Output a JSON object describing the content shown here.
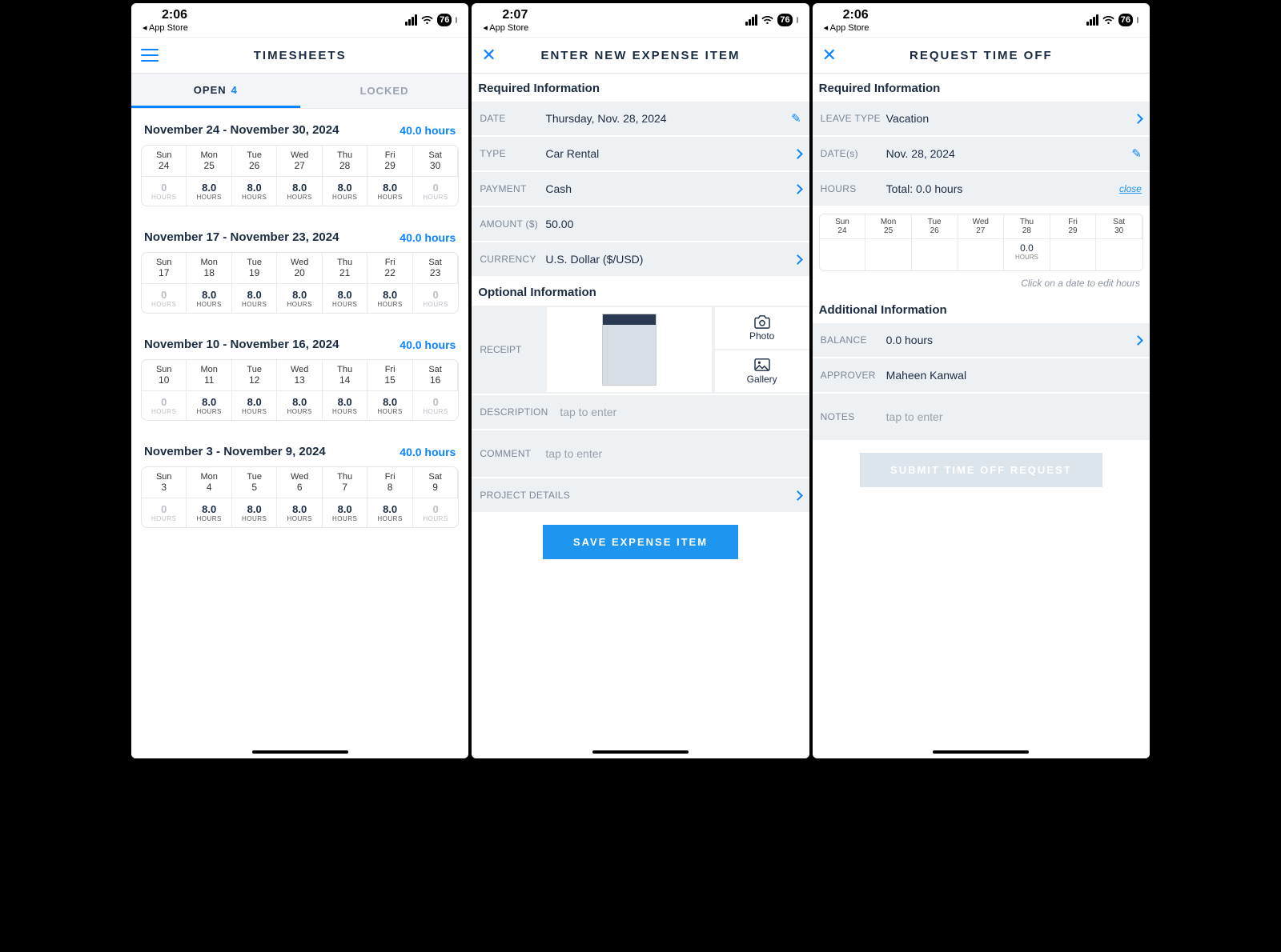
{
  "status": {
    "back": "◂ App Store",
    "battery": "76"
  },
  "screen1": {
    "time": "2:06",
    "title": "TIMESHEETS",
    "tabs": {
      "open_label": "OPEN",
      "open_count": "4",
      "locked_label": "LOCKED"
    },
    "dows": [
      "Sun",
      "Mon",
      "Tue",
      "Wed",
      "Thu",
      "Fri",
      "Sat"
    ],
    "weeks": [
      {
        "range": "November 24 - November 30, 2024",
        "total": "40.0 hours",
        "dates": [
          "24",
          "25",
          "26",
          "27",
          "28",
          "29",
          "30"
        ],
        "hours": [
          "0",
          "8.0",
          "8.0",
          "8.0",
          "8.0",
          "8.0",
          "0"
        ]
      },
      {
        "range": "November 17 - November 23, 2024",
        "total": "40.0 hours",
        "dates": [
          "17",
          "18",
          "19",
          "20",
          "21",
          "22",
          "23"
        ],
        "hours": [
          "0",
          "8.0",
          "8.0",
          "8.0",
          "8.0",
          "8.0",
          "0"
        ]
      },
      {
        "range": "November 10 - November 16, 2024",
        "total": "40.0 hours",
        "dates": [
          "10",
          "11",
          "12",
          "13",
          "14",
          "15",
          "16"
        ],
        "hours": [
          "0",
          "8.0",
          "8.0",
          "8.0",
          "8.0",
          "8.0",
          "0"
        ]
      },
      {
        "range": "November 3 - November 9, 2024",
        "total": "40.0 hours",
        "dates": [
          "3",
          "4",
          "5",
          "6",
          "7",
          "8",
          "9"
        ],
        "hours": [
          "0",
          "8.0",
          "8.0",
          "8.0",
          "8.0",
          "8.0",
          "0"
        ]
      }
    ],
    "unit": "HOURS"
  },
  "screen2": {
    "time": "2:07",
    "title": "ENTER NEW EXPENSE ITEM",
    "section_required": "Required Information",
    "section_optional": "Optional Information",
    "fields": {
      "date_label": "DATE",
      "date_value": "Thursday, Nov. 28, 2024",
      "type_label": "TYPE",
      "type_value": "Car Rental",
      "payment_label": "PAYMENT",
      "payment_value": "Cash",
      "amount_label": "AMOUNT ($)",
      "amount_value": "50.00",
      "currency_label": "CURRENCY",
      "currency_value": "U.S. Dollar ($/USD)",
      "receipt_label": "RECEIPT",
      "photo_label": "Photo",
      "gallery_label": "Gallery",
      "description_label": "DESCRIPTION",
      "description_placeholder": "tap to enter",
      "comment_label": "COMMENT",
      "comment_placeholder": "tap to enter",
      "project_label": "PROJECT DETAILS"
    },
    "save_button": "SAVE EXPENSE ITEM"
  },
  "screen3": {
    "time": "2:06",
    "title": "REQUEST TIME OFF",
    "section_required": "Required Information",
    "section_additional": "Additional Information",
    "fields": {
      "leave_label": "LEAVE TYPE",
      "leave_value": "Vacation",
      "dates_label": "DATE(s)",
      "dates_value": "Nov. 28, 2024",
      "hours_label": "HOURS",
      "hours_value": "Total: 0.0 hours",
      "close_label": "close",
      "balance_label": "BALANCE",
      "balance_value": "0.0 hours",
      "approver_label": "APPROVER",
      "approver_value": "Maheen Kanwal",
      "notes_label": "NOTES",
      "notes_placeholder": "tap to enter"
    },
    "dows": [
      "Sun",
      "Mon",
      "Tue",
      "Wed",
      "Thu",
      "Fri",
      "Sat"
    ],
    "dates": [
      "24",
      "25",
      "26",
      "27",
      "28",
      "29",
      "30"
    ],
    "selected": {
      "index": 4,
      "val": "0.0",
      "unit": "HOURS"
    },
    "hint": "Click on a date to edit hours",
    "submit_button": "SUBMIT TIME OFF REQUEST"
  }
}
